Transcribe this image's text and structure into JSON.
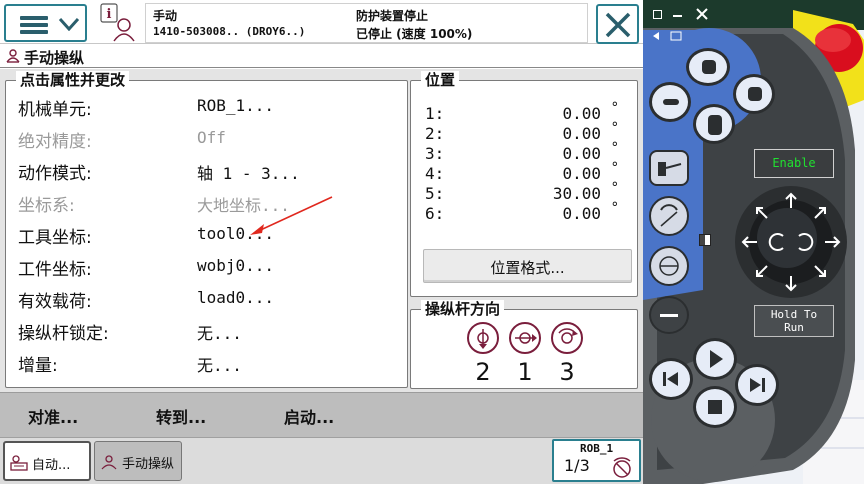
{
  "header": {
    "mode": "手动",
    "system_id": "1410-503008.. (DROY6..)",
    "safety_status": "防护装置停止",
    "run_status": "已停止 (速度 100%)",
    "info_icon": "i"
  },
  "window": {
    "title": "手动操纵"
  },
  "properties": {
    "title": "点击属性并更改",
    "rows": [
      {
        "label": "机械单元:",
        "value": "ROB_1...",
        "enabled": true
      },
      {
        "label": "绝对精度:",
        "value": "Off",
        "enabled": false
      },
      {
        "label": "动作模式:",
        "value": "轴 1 - 3...",
        "enabled": true
      },
      {
        "label": "坐标系:",
        "value": "大地坐标...",
        "enabled": false
      },
      {
        "label": "工具坐标:",
        "value": "tool0...",
        "enabled": true
      },
      {
        "label": "工件坐标:",
        "value": "wobj0...",
        "enabled": true
      },
      {
        "label": "有效载荷:",
        "value": "load0...",
        "enabled": true
      },
      {
        "label": "操纵杆锁定:",
        "value": "无...",
        "enabled": true
      },
      {
        "label": "增量:",
        "value": "无...",
        "enabled": true
      }
    ]
  },
  "position": {
    "title": "位置",
    "rows": [
      {
        "n": "1:",
        "v": "0.00",
        "unit": "°"
      },
      {
        "n": "2:",
        "v": "0.00",
        "unit": "°"
      },
      {
        "n": "3:",
        "v": "0.00",
        "unit": "°"
      },
      {
        "n": "4:",
        "v": "0.00",
        "unit": "°"
      },
      {
        "n": "5:",
        "v": "30.00",
        "unit": "°"
      },
      {
        "n": "6:",
        "v": "0.00",
        "unit": "°"
      }
    ],
    "format_button": "位置格式..."
  },
  "joystick": {
    "title": "操纵杆方向",
    "numbers": [
      "2",
      "1",
      "3"
    ]
  },
  "actions": {
    "align": "对准...",
    "goto": "转到...",
    "activate": "启动..."
  },
  "taskbar": {
    "auto": "自动...",
    "jog": "手动操纵"
  },
  "robot_badge": {
    "name": "ROB_1",
    "speed": "1/3"
  },
  "controller": {
    "enable": "Enable",
    "hold_to_run": "Hold To Run"
  },
  "colors": {
    "accent": "#2a7f8f",
    "joy_accent": "#7a1e3c",
    "pendant_blue": "#4a74c8",
    "emergency": "#d90e1e"
  }
}
